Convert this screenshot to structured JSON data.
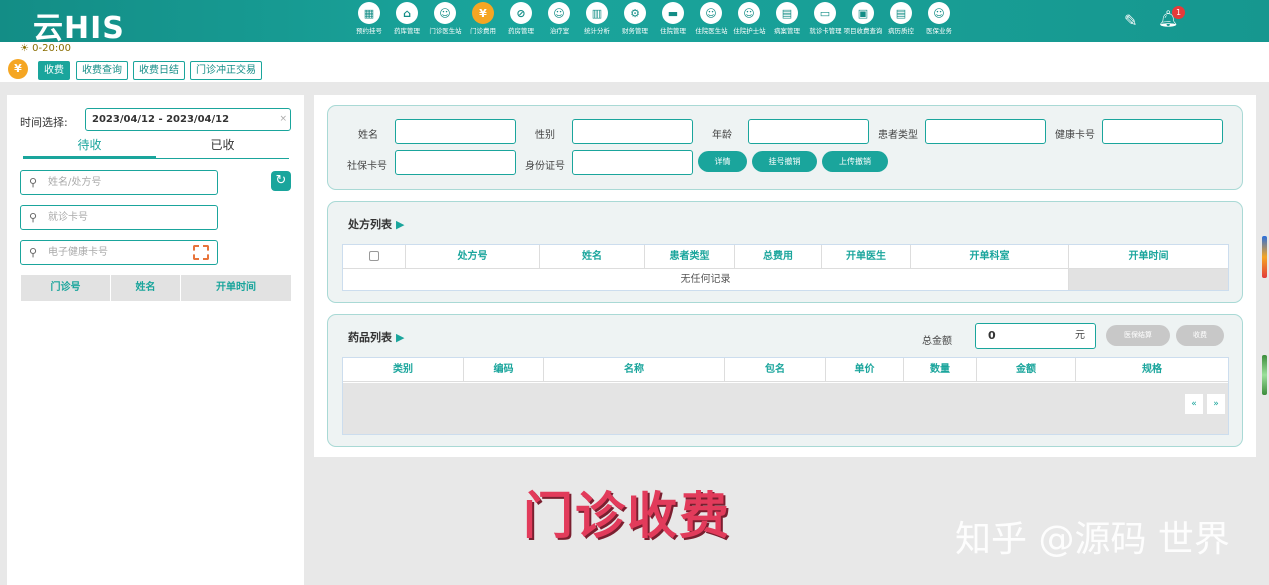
{
  "app": {
    "logo": "云HIS"
  },
  "nav": {
    "items": [
      {
        "label": "预约挂号",
        "icon": "calendar-icon",
        "glyph": "▦"
      },
      {
        "label": "药库管理",
        "icon": "warehouse-icon",
        "glyph": "⌂"
      },
      {
        "label": "门诊医生站",
        "icon": "doctor-icon",
        "glyph": "☺"
      },
      {
        "label": "门诊费用",
        "icon": "yen-coin-icon",
        "glyph": "¥"
      },
      {
        "label": "药房管理",
        "icon": "pill-icon",
        "glyph": "⊘"
      },
      {
        "label": "治疗室",
        "icon": "nurse-icon",
        "glyph": "☺"
      },
      {
        "label": "统计分析",
        "icon": "chart-icon",
        "glyph": "▥"
      },
      {
        "label": "财务管理",
        "icon": "gear-icon",
        "glyph": "⚙"
      },
      {
        "label": "住院管理",
        "icon": "bed-icon",
        "glyph": "▬"
      },
      {
        "label": "住院医生站",
        "icon": "doctor-card-icon",
        "glyph": "☺"
      },
      {
        "label": "住院护士站",
        "icon": "nurse-card-icon",
        "glyph": "☺"
      },
      {
        "label": "病案管理",
        "icon": "record-icon",
        "glyph": "▤"
      },
      {
        "label": "就诊卡管理",
        "icon": "card-icon",
        "glyph": "▭"
      },
      {
        "label": "项目收费查询",
        "icon": "doc-search-icon",
        "glyph": "▣"
      },
      {
        "label": "病历质控",
        "icon": "clipboard-icon",
        "glyph": "▤"
      },
      {
        "label": "医保业务",
        "icon": "id-card-icon",
        "glyph": "☺"
      }
    ],
    "active_index": 3,
    "bell_count": "1"
  },
  "subbar": {
    "shift": "0-20:00",
    "tabs": [
      "收费",
      "收费查询",
      "收费日结",
      "门诊冲正交易"
    ]
  },
  "left": {
    "time_label": "时间选择:",
    "date_range": "2023/04/12 - 2023/04/12",
    "tabs": [
      "待收",
      "已收"
    ],
    "search_name_placeholder": "姓名/处方号",
    "search_visit_placeholder": "就诊卡号",
    "search_health_placeholder": "电子健康卡号",
    "columns": [
      "门诊号",
      "姓名",
      "开单时间"
    ]
  },
  "form": {
    "labels": {
      "name": "姓名",
      "gender": "性别",
      "age": "年龄",
      "patient_type": "患者类型",
      "health_card": "健康卡号",
      "social_card": "社保卡号",
      "id_card": "身份证号"
    },
    "buttons": [
      "详情",
      "挂号撤销",
      "上传撤销"
    ]
  },
  "prescriptions": {
    "title": "处方列表",
    "columns": [
      "处方号",
      "姓名",
      "患者类型",
      "总费用",
      "开单医生",
      "开单科室",
      "开单时间"
    ],
    "empty_text": "无任何记录"
  },
  "drugs": {
    "title": "药品列表",
    "total_label": "总金额",
    "total_value": "0",
    "unit": "元",
    "buttons": [
      "医保结算",
      "收费"
    ],
    "columns": [
      "类别",
      "编码",
      "名称",
      "包名",
      "单价",
      "数量",
      "金额",
      "规格"
    ],
    "pager": [
      "«",
      "»"
    ]
  },
  "overlay": {
    "caption": "门诊收费",
    "watermark": "知乎 @源码 世界"
  }
}
